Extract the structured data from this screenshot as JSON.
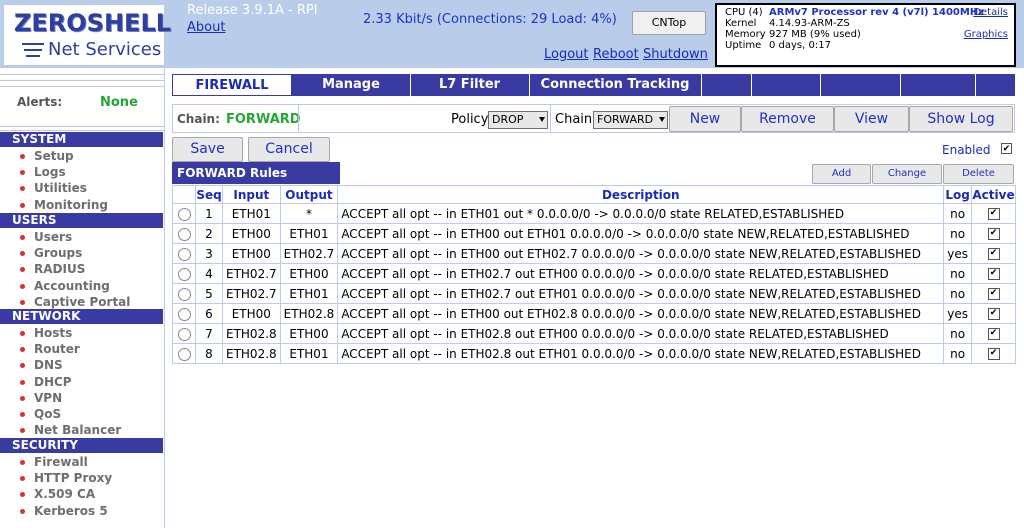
{
  "header": {
    "logo_text": "ZEROSHELL",
    "logo_sub": "Net Services",
    "release": "Release 3.9.1A - RPI",
    "about": "About",
    "traffic": "2.33 Kbit/s (Connections: 29 Load: 4%)",
    "cntop": "CNTop",
    "links": {
      "logout": "Logout",
      "reboot": "Reboot",
      "shutdown": "Shutdown"
    },
    "sysinfo": {
      "cpu_label": "CPU (4)",
      "cpu_value": "ARMv7 Processor rev 4 (v7l) 1400MHz",
      "details": "Details",
      "kernel_label": "Kernel",
      "kernel_value": "4.14.93-ARM-ZS",
      "memory_label": "Memory",
      "memory_value": "927 MB  (9% used)",
      "graphics": "Graphics",
      "uptime_label": "Uptime",
      "uptime_value": "0 days, 0:17"
    }
  },
  "sidebar": {
    "alerts_label": "Alerts:",
    "alerts_value": "None",
    "sections": [
      {
        "title": "SYSTEM",
        "items": [
          "Setup",
          "Logs",
          "Utilities",
          "Monitoring"
        ]
      },
      {
        "title": "USERS",
        "items": [
          "Users",
          "Groups",
          "RADIUS",
          "Accounting",
          "Captive Portal"
        ]
      },
      {
        "title": "NETWORK",
        "items": [
          "Hosts",
          "Router",
          "DNS",
          "DHCP",
          "VPN",
          "QoS",
          "Net Balancer"
        ]
      },
      {
        "title": "SECURITY",
        "items": [
          "Firewall",
          "HTTP Proxy",
          "X.509 CA",
          "Kerberos 5"
        ]
      }
    ]
  },
  "tabs": [
    "FIREWALL",
    "Manage",
    "L7 Filter",
    "Connection Tracking"
  ],
  "chainbar": {
    "chain_label": "Chain:",
    "chain_value": "FORWARD",
    "policy_label": "Policy",
    "policy_value": "DROP",
    "chain2_label": "Chain",
    "chain2_value": "FORWARD",
    "new": "New",
    "remove": "Remove",
    "view": "View",
    "showlog": "Show Log"
  },
  "actions": {
    "save": "Save",
    "cancel": "Cancel",
    "enabled": "Enabled"
  },
  "rules": {
    "title": "FORWARD Rules",
    "add": "Add",
    "change": "Change",
    "delete": "Delete",
    "columns": [
      "Seq",
      "Input",
      "Output",
      "Description",
      "Log",
      "Active"
    ],
    "rows": [
      {
        "seq": "1",
        "input": "ETH01",
        "output": "*",
        "desc": "ACCEPT all opt -- in ETH01 out * 0.0.0.0/0 -> 0.0.0.0/0 state RELATED,ESTABLISHED",
        "log": "no",
        "active": true
      },
      {
        "seq": "2",
        "input": "ETH00",
        "output": "ETH01",
        "desc": "ACCEPT all opt -- in ETH00 out ETH01 0.0.0.0/0 -> 0.0.0.0/0 state NEW,RELATED,ESTABLISHED",
        "log": "no",
        "active": true
      },
      {
        "seq": "3",
        "input": "ETH00",
        "output": "ETH02.7",
        "desc": "ACCEPT all opt -- in ETH00 out ETH02.7 0.0.0.0/0 -> 0.0.0.0/0 state NEW,RELATED,ESTABLISHED",
        "log": "yes",
        "active": true
      },
      {
        "seq": "4",
        "input": "ETH02.7",
        "output": "ETH00",
        "desc": "ACCEPT all opt -- in ETH02.7 out ETH00 0.0.0.0/0 -> 0.0.0.0/0 state RELATED,ESTABLISHED",
        "log": "no",
        "active": true
      },
      {
        "seq": "5",
        "input": "ETH02.7",
        "output": "ETH01",
        "desc": "ACCEPT all opt -- in ETH02.7 out ETH01 0.0.0.0/0 -> 0.0.0.0/0 state NEW,RELATED,ESTABLISHED",
        "log": "no",
        "active": true
      },
      {
        "seq": "6",
        "input": "ETH00",
        "output": "ETH02.8",
        "desc": "ACCEPT all opt -- in ETH00 out ETH02.8 0.0.0.0/0 -> 0.0.0.0/0 state NEW,RELATED,ESTABLISHED",
        "log": "yes",
        "active": true
      },
      {
        "seq": "7",
        "input": "ETH02.8",
        "output": "ETH00",
        "desc": "ACCEPT all opt -- in ETH02.8 out ETH00 0.0.0.0/0 -> 0.0.0.0/0 state RELATED,ESTABLISHED",
        "log": "no",
        "active": true
      },
      {
        "seq": "8",
        "input": "ETH02.8",
        "output": "ETH01",
        "desc": "ACCEPT all opt -- in ETH02.8 out ETH01 0.0.0.0/0 -> 0.0.0.0/0 state NEW,RELATED,ESTABLISHED",
        "log": "no",
        "active": true
      }
    ]
  }
}
